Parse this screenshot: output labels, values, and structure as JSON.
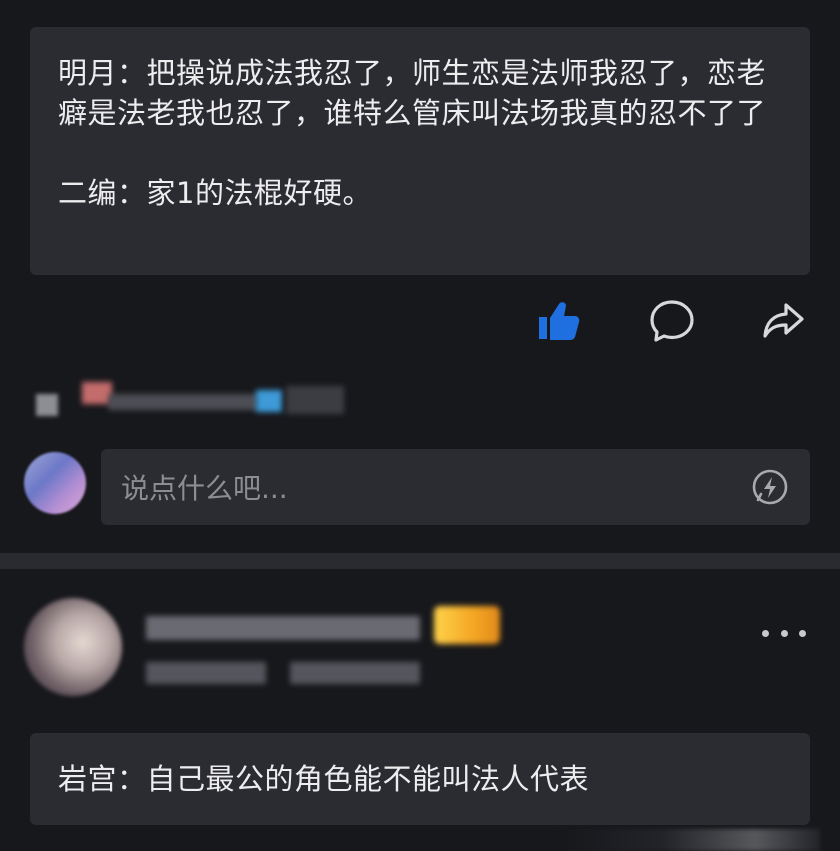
{
  "post": {
    "line1": "明月：把操说成法我忍了，师生恋是法师我忍了，恋老癖是法老我也忍了，谁特么管床叫法场我真的忍不了了",
    "line2": "二编：家1的法棍好硬。"
  },
  "actions": {
    "like_icon": "thumbs-up-icon",
    "comment_icon": "comment-bubble-icon",
    "share_icon": "share-arrow-icon",
    "like_color": "#1f6fe0"
  },
  "reply": {
    "placeholder": "说点什么吧...",
    "fast_icon": "lightning-bubble-icon"
  },
  "comment2": {
    "text": "岩宫：自己最公的角色能不能叫法人代表",
    "more_icon": "more-dots-icon"
  },
  "colors": {
    "background": "#17181c",
    "card": "#2b2c31",
    "text": "#ededef",
    "placeholder": "#8c8d93"
  }
}
